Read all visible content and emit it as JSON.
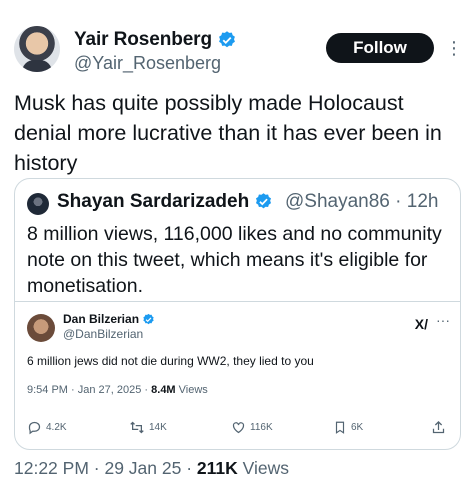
{
  "author": {
    "name": "Yair Rosenberg",
    "handle": "@Yair_Rosenberg"
  },
  "follow_label": "Follow",
  "tweet_text": "Musk has quite possibly made Holocaust denial more lucrative than it has ever been in history",
  "quoted": {
    "name": "Shayan Sardarizadeh",
    "handle_time": "@Shayan86 · 12h",
    "text": "8 million views, 116,000 likes and no community note on this tweet, which means it's eligible for monetisation."
  },
  "embedded": {
    "name": "Dan Bilzerian",
    "handle": "@DanBilzerian",
    "text": "6 million jews did not die during WW2, they lied to you",
    "time": "9:54 PM · Jan 27, 2025 · ",
    "views_value": "8.4M",
    "views_label": " Views",
    "actions": {
      "replies": "4.2K",
      "reposts": "14K",
      "likes": "116K",
      "bookmarks": "6K"
    }
  },
  "footer": {
    "time": "12:22 PM · 29 Jan 25 · ",
    "views_value": "211K",
    "views_label": " Views"
  },
  "colors": {
    "verified": "#1d9bf0",
    "text": "#0f1419",
    "secondary": "#536471",
    "border": "#cfd9de"
  }
}
